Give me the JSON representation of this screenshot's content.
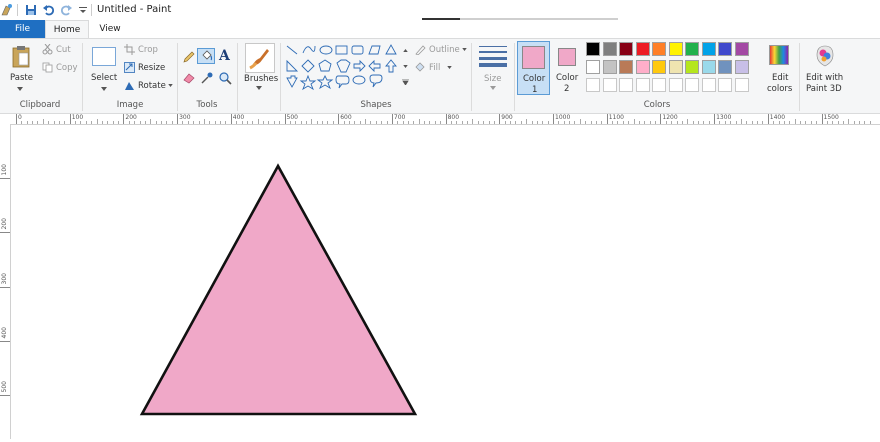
{
  "window": {
    "title": "Untitled - Paint"
  },
  "tabs": [
    {
      "label": "File"
    },
    {
      "label": "Home"
    },
    {
      "label": "View"
    }
  ],
  "clipboard": {
    "paste": "Paste",
    "cut": "Cut",
    "copy": "Copy",
    "group": "Clipboard"
  },
  "image": {
    "select": "Select",
    "crop": "Crop",
    "resize": "Resize",
    "rotate": "Rotate",
    "group": "Image"
  },
  "tools": {
    "group": "Tools"
  },
  "brushes": {
    "label": "Brushes"
  },
  "shapes": {
    "outline": "Outline",
    "fill": "Fill",
    "group": "Shapes"
  },
  "size": {
    "label": "Size"
  },
  "colors": {
    "color1_line1": "Color",
    "color1_line2": "1",
    "color2_line1": "Color",
    "color2_line2": "2",
    "edit_line1": "Edit",
    "edit_line2": "colors",
    "paint3d_line1": "Edit with",
    "paint3d_line2": "Paint 3D",
    "group": "Colors",
    "color1": "#f0a8c8",
    "color2": "#f0a8c8",
    "palette_row1": [
      "#000000",
      "#7f7f7f",
      "#880015",
      "#ed1c24",
      "#ff7f27",
      "#fff200",
      "#22b14c",
      "#00a2e8",
      "#3f48cc",
      "#a349a4"
    ],
    "palette_row2": [
      "#ffffff",
      "#c3c3c3",
      "#b97a57",
      "#ffaec9",
      "#ffc90e",
      "#efe4b0",
      "#b5e61d",
      "#99d9ea",
      "#7092be",
      "#c8bfe7"
    ]
  },
  "ruler": {
    "h_marks": [
      "0",
      "100",
      "200",
      "300",
      "400",
      "500",
      "600",
      "700",
      "800",
      "900",
      "1000",
      "1100",
      "1200",
      "1300",
      "1400",
      "1500"
    ],
    "v_marks": [
      "100",
      "200",
      "300",
      "400",
      "500"
    ]
  },
  "canvas": {
    "shape_fill": "#f0a8c8",
    "shape_stroke": "#111111"
  }
}
